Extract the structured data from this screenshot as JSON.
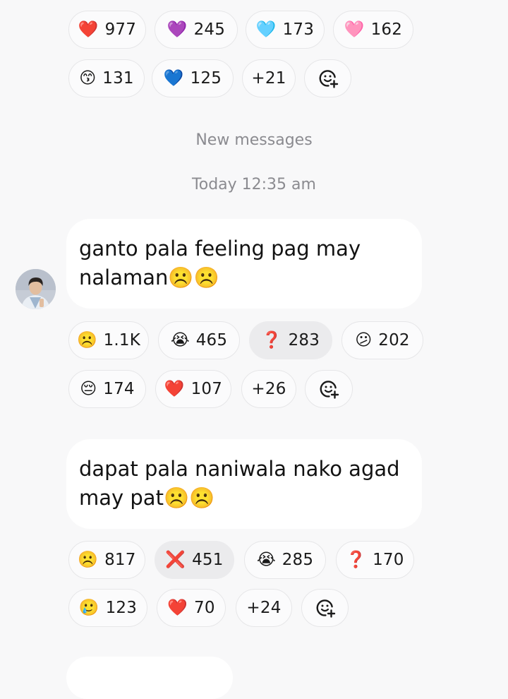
{
  "top_reactions": {
    "row1": [
      {
        "emoji": "❤️",
        "count": "977"
      },
      {
        "emoji": "💜",
        "count": "245"
      },
      {
        "emoji": "🩵",
        "count": "173"
      },
      {
        "emoji": "🩷",
        "count": "162"
      }
    ],
    "row2": [
      {
        "emoji": "😙",
        "count": "131"
      },
      {
        "emoji": "💙",
        "count": "125"
      },
      {
        "more": "+21"
      }
    ]
  },
  "divider": {
    "new_messages": "New messages",
    "timestamp": "Today 12:35 am"
  },
  "messages": [
    {
      "line1": "ganto pala feeling pag may",
      "line2": "nalaman",
      "line2_emoji": "☹️☹️",
      "reactions_row1": [
        {
          "emoji": "☹️",
          "count": "1.1K"
        },
        {
          "emoji": "😭",
          "count": "465"
        },
        {
          "emoji": "❓",
          "count": "283",
          "selected": true
        },
        {
          "emoji": "😕",
          "count": "202"
        }
      ],
      "reactions_row2": [
        {
          "emoji": "😔",
          "count": "174"
        },
        {
          "emoji": "❤️",
          "count": "107"
        },
        {
          "more": "+26"
        }
      ]
    },
    {
      "line1": "dapat pala naniwala nako agad",
      "line2": "may pat",
      "line2_emoji": "☹️☹️",
      "reactions_row1": [
        {
          "emoji": "☹️",
          "count": "817"
        },
        {
          "emoji": "❌",
          "count": "451",
          "selected": true
        },
        {
          "emoji": "😭",
          "count": "285"
        },
        {
          "emoji": "❓",
          "count": "170"
        }
      ],
      "reactions_row2": [
        {
          "emoji": "🥲",
          "count": "123"
        },
        {
          "emoji": "❤️",
          "count": "70"
        },
        {
          "more": "+24"
        }
      ]
    }
  ],
  "icons": {
    "add_reaction": "add-reaction-icon",
    "avatar": "avatar"
  }
}
